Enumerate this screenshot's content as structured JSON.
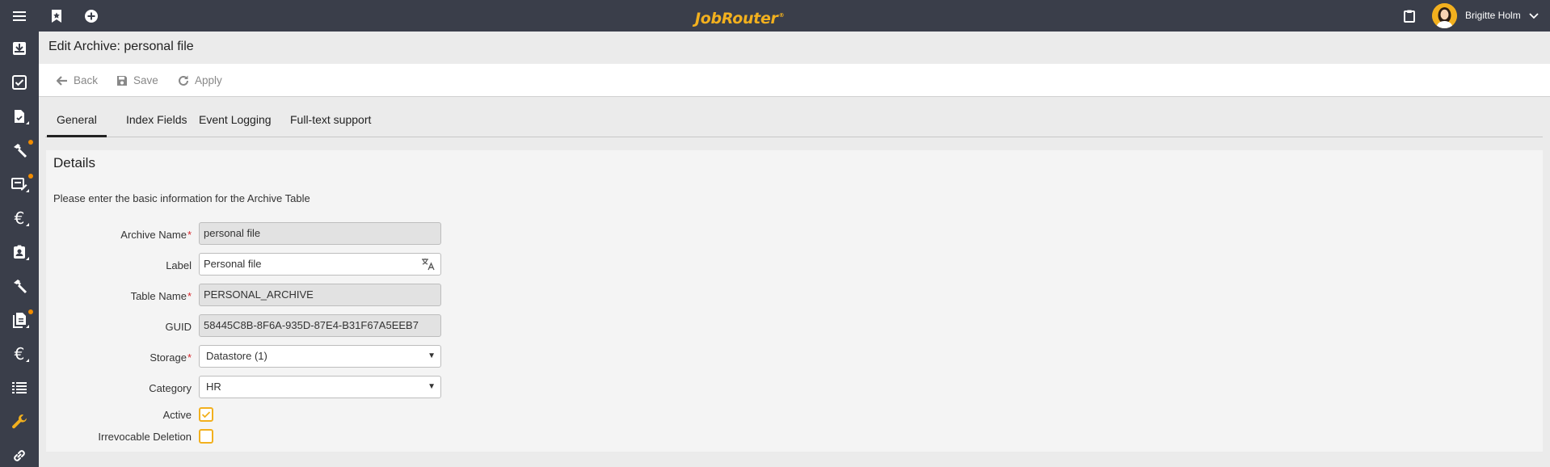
{
  "app": {
    "logo_text": "JobRouter",
    "logo_mark": "®",
    "user_name": "Brigitte Holm",
    "accent": "#f2b01e"
  },
  "topbar": {
    "icons": [
      "menu-icon",
      "bookmark-icon",
      "add-circle-icon",
      "clipboard-icon",
      "chevron-down-icon"
    ]
  },
  "sidebar": {
    "items": [
      {
        "icon": "inbox-icon"
      },
      {
        "icon": "checkbox-icon"
      },
      {
        "icon": "document-check-icon",
        "notification": true
      },
      {
        "icon": "hammer-icon",
        "notification": true
      },
      {
        "icon": "form-edit-icon",
        "notification": true
      },
      {
        "icon": "euro-icon"
      },
      {
        "icon": "contact-badge-icon"
      },
      {
        "icon": "hammer-icon"
      },
      {
        "icon": "documents-icon",
        "notification": true
      },
      {
        "icon": "euro-icon"
      },
      {
        "icon": "list-icon"
      },
      {
        "icon": "wrench-icon",
        "active": true
      },
      {
        "icon": "link-icon"
      }
    ]
  },
  "header": {
    "title": "Edit Archive: personal file"
  },
  "toolbar": {
    "back_label": "Back",
    "save_label": "Save",
    "apply_label": "Apply"
  },
  "tabs": [
    {
      "label": "General",
      "active": true
    },
    {
      "label": "Index Fields"
    },
    {
      "label": "Event Logging"
    },
    {
      "label": "Full-text support"
    }
  ],
  "details": {
    "title": "Details",
    "description": "Please enter the basic information for the Archive Table",
    "fields": {
      "archive_name": {
        "label": "Archive Name",
        "value": "personal file",
        "required": true
      },
      "label": {
        "label": "Label",
        "value": "Personal file"
      },
      "table_name": {
        "label": "Table Name",
        "value": "PERSONAL_ARCHIVE",
        "required": true
      },
      "guid": {
        "label": "GUID",
        "value": "58445C8B-8F6A-935D-87E4-B31F67A5EEB7"
      },
      "storage": {
        "label": "Storage",
        "value": "Datastore (1)",
        "required": true
      },
      "category": {
        "label": "Category",
        "value": "HR"
      },
      "active": {
        "label": "Active",
        "checked": true
      },
      "irrevocable_deletion": {
        "label": "Irrevocable Deletion",
        "checked": false
      }
    },
    "required_mark": "*"
  }
}
